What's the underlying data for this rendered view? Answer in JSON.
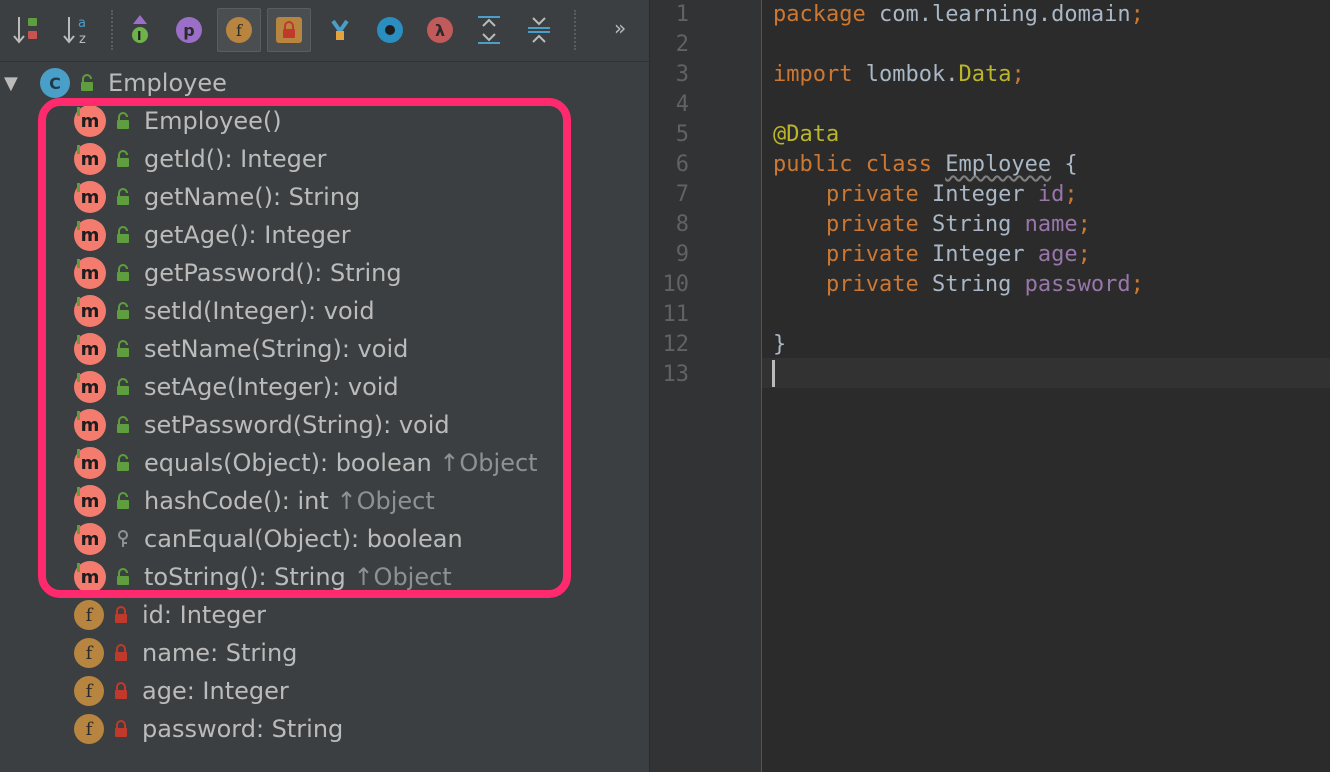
{
  "toolbar": {
    "buttons": [
      {
        "name": "sort-by-visibility",
        "glyph": "↓"
      },
      {
        "name": "sort-alphabetically",
        "glyph": "↓"
      },
      {
        "name": "show-inherited",
        "letter": "I",
        "color": "#6fb24b"
      },
      {
        "name": "show-properties",
        "letter": "p",
        "color": "#9b6fc7"
      },
      {
        "name": "show-fields",
        "letter": "f",
        "color": "#b88540"
      },
      {
        "name": "show-non-public",
        "color": "#b8602f"
      },
      {
        "name": "show-anonymous",
        "color": "#4a9fc9"
      },
      {
        "name": "show-lambdas",
        "letter": "λ",
        "color": "#c15b5b"
      }
    ],
    "sort_az_label": "a z",
    "lambda_letter": "λ",
    "p_letter": "p",
    "f_letter": "f",
    "i_letter": "I",
    "overflow": "»"
  },
  "tree": {
    "root": {
      "icon_letter": "C",
      "label": "Employee"
    },
    "methods": [
      {
        "sig": "Employee()",
        "inherited": "",
        "visibility": "public"
      },
      {
        "sig": "getId(): Integer",
        "inherited": "",
        "visibility": "public"
      },
      {
        "sig": "getName(): String",
        "inherited": "",
        "visibility": "public"
      },
      {
        "sig": "getAge(): Integer",
        "inherited": "",
        "visibility": "public"
      },
      {
        "sig": "getPassword(): String",
        "inherited": "",
        "visibility": "public"
      },
      {
        "sig": "setId(Integer): void",
        "inherited": "",
        "visibility": "public"
      },
      {
        "sig": "setName(String): void",
        "inherited": "",
        "visibility": "public"
      },
      {
        "sig": "setAge(Integer): void",
        "inherited": "",
        "visibility": "public"
      },
      {
        "sig": "setPassword(String): void",
        "inherited": "",
        "visibility": "public"
      },
      {
        "sig": "equals(Object): boolean",
        "inherited": "↑Object",
        "visibility": "public"
      },
      {
        "sig": "hashCode(): int",
        "inherited": "↑Object",
        "visibility": "public"
      },
      {
        "sig": "canEqual(Object): boolean",
        "inherited": "",
        "visibility": "protected"
      },
      {
        "sig": "toString(): String",
        "inherited": "↑Object",
        "visibility": "public"
      }
    ],
    "fields": [
      {
        "sig": "id: Integer"
      },
      {
        "sig": "name: String"
      },
      {
        "sig": "age: Integer"
      },
      {
        "sig": "password: String"
      }
    ],
    "method_icon_letter": "m",
    "field_icon_letter": "f",
    "expand_arrow": "▼"
  },
  "editor": {
    "line_numbers": [
      "1",
      "2",
      "3",
      "4",
      "5",
      "6",
      "7",
      "8",
      "9",
      "10",
      "11",
      "12",
      "13"
    ],
    "lines": {
      "l1_kw": "package",
      "l1_rest": " com.learning.domain",
      "l1_semi": ";",
      "l3_kw": "import",
      "l3_rest": " lombok.",
      "l3_ann": "Data",
      "l3_semi": ";",
      "l5_ann": "@Data",
      "l6_kw": "public class",
      "l6_space": " ",
      "l6_cls": "Employee",
      "l6_brace": " {",
      "fields": [
        {
          "kw": "private",
          "type": " Integer ",
          "name": "id",
          "semi": ";"
        },
        {
          "kw": "private",
          "type": " String ",
          "name": "name",
          "semi": ";"
        },
        {
          "kw": "private",
          "type": " Integer ",
          "name": "age",
          "semi": ";"
        },
        {
          "kw": "private",
          "type": " String ",
          "name": "password",
          "semi": ";"
        }
      ],
      "l12_brace": "}"
    }
  }
}
